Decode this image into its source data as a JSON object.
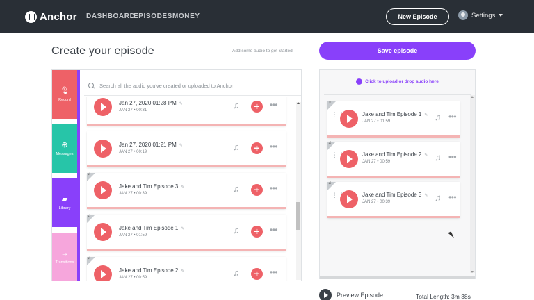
{
  "nav": {
    "logo": "Anchor",
    "links": [
      "DASHBOARD",
      "EPISODES",
      "MONEY"
    ],
    "new_episode": "New Episode",
    "settings": "Settings"
  },
  "page": {
    "title": "Create your episode",
    "hint": "Add some audio to get started!",
    "save_button": "Save episode"
  },
  "sidebar": {
    "tabs": [
      {
        "label": "Record",
        "icon": "microphone-icon",
        "color": "#ee6167"
      },
      {
        "label": "Messages",
        "icon": "plus-circle-icon",
        "color": "#27c5a8"
      },
      {
        "label": "Library",
        "icon": "folder-icon",
        "color": "#8940fa"
      },
      {
        "label": "Transitions",
        "icon": "arrow-right-icon",
        "color": "#f6a6dc"
      }
    ]
  },
  "library": {
    "search_placeholder": "Search all the audio you've created or uploaded to Anchor",
    "items": [
      {
        "title": "Jan 27, 2020 01:28 PM",
        "date": "JAN 27",
        "duration": "00:31"
      },
      {
        "title": "Jan 27, 2020 01:21 PM",
        "date": "JAN 27",
        "duration": "00:19"
      },
      {
        "title": "Jake and Tim Episode 3",
        "date": "JAN 27",
        "duration": "00:39"
      },
      {
        "title": "Jake and Tim Episode 1",
        "date": "JAN 27",
        "duration": "01:59"
      },
      {
        "title": "Jake and Tim Episode 2",
        "date": "JAN 27",
        "duration": "00:59"
      }
    ]
  },
  "episode": {
    "upload_text": "Click to upload or drop audio here",
    "segments": [
      {
        "title": "Jake and Tim Episode 1",
        "date": "JAN 27",
        "duration": "01:59"
      },
      {
        "title": "Jake and Tim Episode 2",
        "date": "JAN 27",
        "duration": "00:59"
      },
      {
        "title": "Jake and Tim Episode 3",
        "date": "JAN 27",
        "duration": "00:39"
      }
    ],
    "preview": "Preview Episode",
    "total_length": "Total Length: 3m 38s"
  },
  "colors": {
    "nav_bg": "#292f36",
    "accent_purple": "#8940fa",
    "play_red": "#ee6167"
  }
}
